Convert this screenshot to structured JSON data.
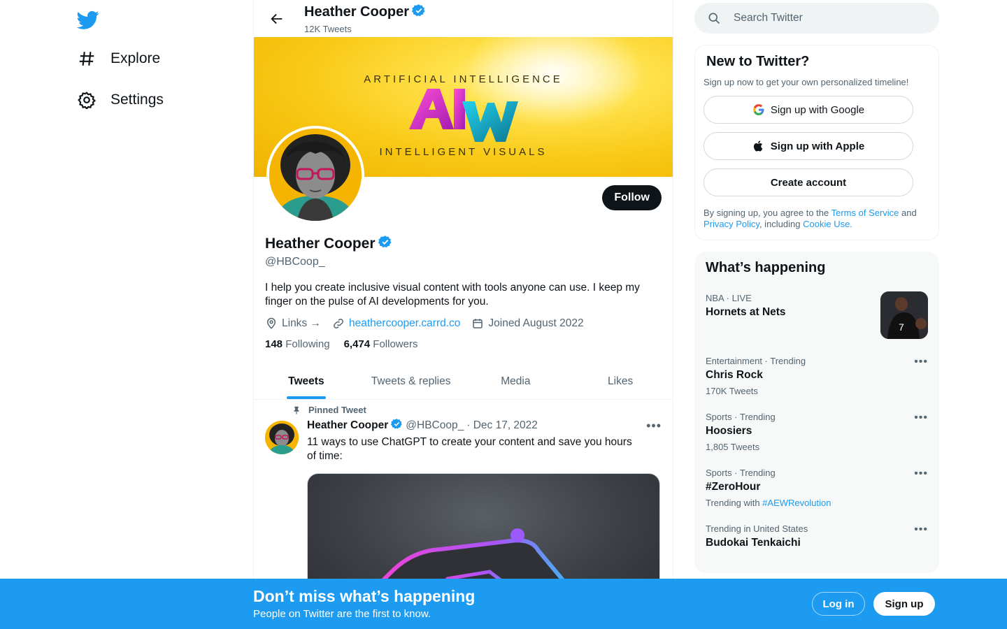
{
  "nav": {
    "items": [
      {
        "label": "Explore",
        "icon": "hashtag-icon"
      },
      {
        "label": "Settings",
        "icon": "gear-icon"
      }
    ]
  },
  "header": {
    "name": "Heather Cooper",
    "tweet_count": "12K Tweets"
  },
  "banner": {
    "line1": "ARTIFICIAL INTELLIGENCE",
    "logo": "AIV",
    "line2": "INTELLIGENT VISUALS"
  },
  "profile": {
    "follow_label": "Follow",
    "name": "Heather Cooper",
    "handle": "@HBCoop_",
    "bio": "I help you create inclusive visual content with tools anyone can use. I keep my finger on the pulse of AI developments for you.",
    "links_label": "Links →",
    "website": "heathercooper.carrd.co",
    "joined": "Joined August 2022",
    "following_count": "148",
    "following_label": "Following",
    "followers_count": "6,474",
    "followers_label": "Followers"
  },
  "tabs": [
    "Tweets",
    "Tweets & replies",
    "Media",
    "Likes"
  ],
  "tweet": {
    "pinned_label": "Pinned Tweet",
    "name": "Heather Cooper",
    "handle": "@HBCoop_",
    "date": "· Dec 17, 2022",
    "text": "11 ways to use ChatGPT to create your content and save you hours of time:"
  },
  "search": {
    "placeholder": "Search Twitter"
  },
  "signup_card": {
    "title": "New to Twitter?",
    "subtitle": "Sign up now to get your own personalized timeline!",
    "google": "Sign up with Google",
    "apple": "Sign up with Apple",
    "create": "Create account",
    "terms_prefix": "By signing up, you agree to the ",
    "terms_link": "Terms of Service",
    "terms_and": " and ",
    "privacy_link": "Privacy Policy",
    "including": ", including ",
    "cookie_link": "Cookie Use."
  },
  "happening": {
    "title": "What’s happening",
    "trends": [
      {
        "category": "NBA · LIVE",
        "title": "Hornets at Nets",
        "count": ""
      },
      {
        "category": "Entertainment · Trending",
        "title": "Chris Rock",
        "count": "170K Tweets"
      },
      {
        "category": "Sports · Trending",
        "title": "Hoosiers",
        "count": "1,805 Tweets"
      },
      {
        "category": "Sports · Trending",
        "title": "#ZeroHour",
        "count_prefix": "Trending with ",
        "count_link": "#AEWRevolution"
      },
      {
        "category": "Trending in United States",
        "title": "Budokai Tenkaichi",
        "count": ""
      }
    ]
  },
  "bottom": {
    "heading": "Don’t miss what’s happening",
    "sub": "People on Twitter are the first to know.",
    "login": "Log in",
    "signup": "Sign up"
  },
  "colors": {
    "accent": "#1d9bf0",
    "text": "#0f1419",
    "muted": "#536471"
  }
}
